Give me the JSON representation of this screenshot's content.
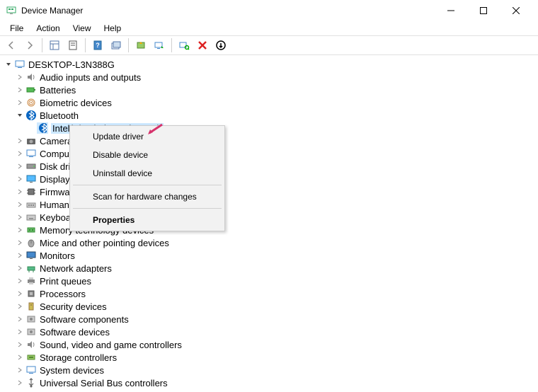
{
  "window": {
    "title": "Device Manager"
  },
  "menu": {
    "file": "File",
    "action": "Action",
    "view": "View",
    "help": "Help"
  },
  "tree": {
    "root": "DESKTOP-L3N388G",
    "nodes": {
      "audio": "Audio inputs and outputs",
      "batteries": "Batteries",
      "biometric": "Biometric devices",
      "bluetooth": "Bluetooth",
      "bt_device": "Intel(R) Wireless Bluetooth",
      "cameras": "Cameras",
      "computer": "Computer",
      "disk": "Disk drives",
      "display": "Display adapters",
      "firmware": "Firmware",
      "hid": "Human Interface Devices",
      "keyboards": "Keyboards",
      "memtech": "Memory technology devices",
      "mice": "Mice and other pointing devices",
      "monitors": "Monitors",
      "network": "Network adapters",
      "print": "Print queues",
      "processors": "Processors",
      "security": "Security devices",
      "swcomp": "Software components",
      "swdev": "Software devices",
      "sound": "Sound, video and game controllers",
      "storage": "Storage controllers",
      "system": "System devices",
      "usb": "Universal Serial Bus controllers"
    }
  },
  "context": {
    "update": "Update driver",
    "disable": "Disable device",
    "uninstall": "Uninstall device",
    "scan": "Scan for hardware changes",
    "properties": "Properties"
  }
}
